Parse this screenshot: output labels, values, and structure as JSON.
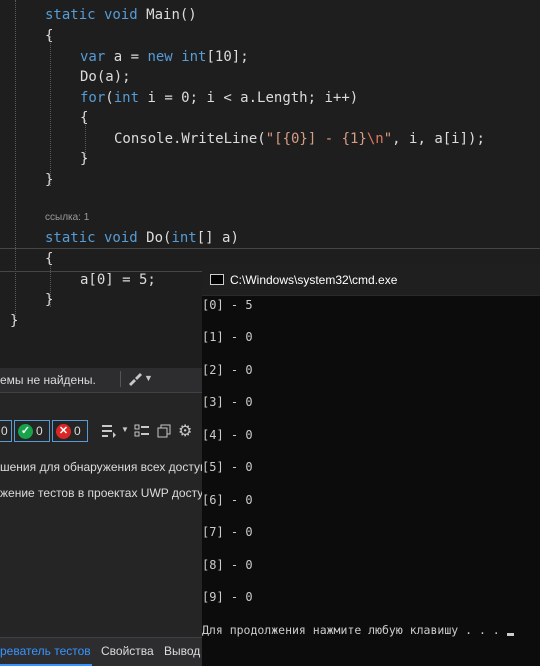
{
  "editor": {
    "lines": {
      "main_sig": {
        "kw": "static void ",
        "name": "Main()"
      },
      "open1": "{",
      "var_decl": {
        "kw1": "var",
        "mid": " a = ",
        "kw2": "new",
        "sp": " ",
        "kw3": "int",
        "rest": "[10];"
      },
      "do_call": "Do(a);",
      "for_line": {
        "kw1": "for",
        "p1": "(",
        "kw2": "int",
        "rest": " i = 0; i < a.Length; i++)"
      },
      "open2": "{",
      "writeline": {
        "pre": "Console.WriteLine(",
        "s1": "\"[{0}] - {1}",
        "esc": "\\n",
        "s2": "\"",
        "rest": ", i, a[i]);"
      },
      "close2": "}",
      "close1": "}",
      "codelens": "ссылка: 1",
      "do_sig": {
        "kw1": "static void ",
        "name": "Do(",
        "kw2": "int",
        "rest": "[] a)"
      },
      "open3": "{",
      "assign": "a[0] = 5;",
      "close3": "}",
      "close_class": "}"
    }
  },
  "panel": {
    "toolbar_text": "емы не найдены.",
    "counts": {
      "first": "0",
      "passed": "0",
      "failed": "0"
    },
    "messages": [
      "шения для обнаружения всех доступ",
      "жение тестов в проектах UWP достуг"
    ],
    "tabs": [
      "реватель тестов",
      "Свойства",
      "Вывод"
    ]
  },
  "cmd": {
    "title": "C:\\Windows\\system32\\cmd.exe",
    "output": [
      "[0] - 5",
      "[1] - 0",
      "[2] - 0",
      "[3] - 0",
      "[4] - 0",
      "[5] - 0",
      "[6] - 0",
      "[7] - 0",
      "[8] - 0",
      "[9] - 0"
    ],
    "prompt": "Для продолжения нажмите любую клавишу . . . "
  },
  "colors": {
    "keyword": "#569cd6",
    "string": "#d69d85",
    "tab_active": "#3794ff",
    "passed": "#16a34a",
    "failed": "#dc2626"
  }
}
